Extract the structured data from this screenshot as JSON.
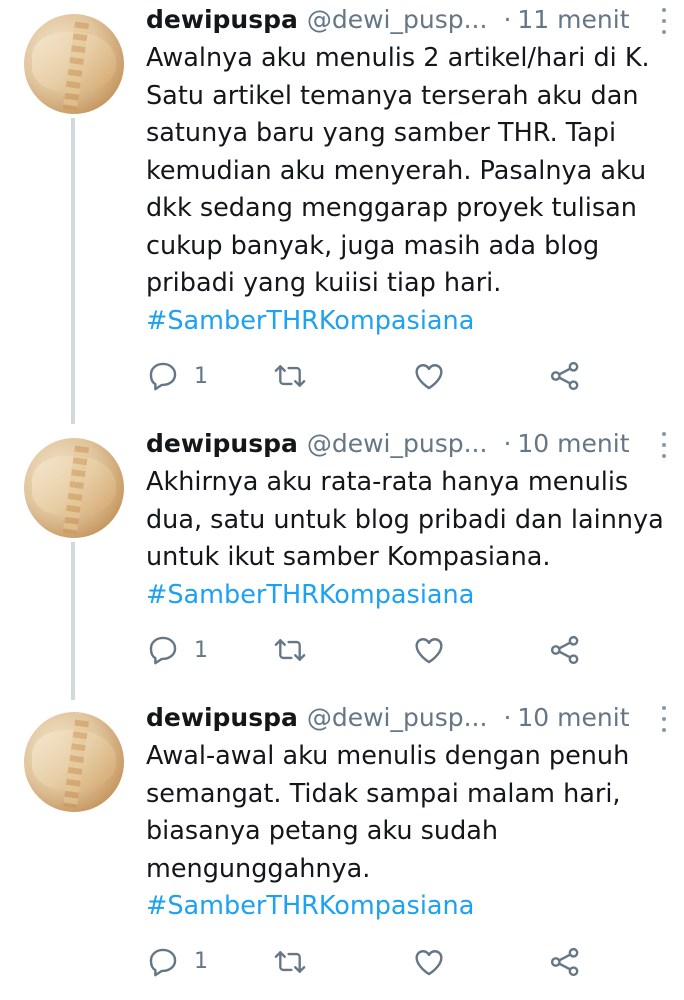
{
  "tweets": [
    {
      "name": "dewipuspa",
      "handle": "@dewi_pusp...",
      "time": "11 menit",
      "lines": [
        "Awalnya aku menulis 2 artikel/hari di K.",
        "Satu artikel temanya terserah aku dan",
        "satunya baru yang samber THR. Tapi",
        "kemudian aku menyerah. Pasalnya aku",
        "dkk sedang menggarap proyek tulisan",
        "cukup banyak, juga masih ada blog",
        "pribadi yang kuiisi tiap hari."
      ],
      "hashtag": "#SamberTHRKompasiana",
      "reply_count": "1",
      "icons": [
        "reply-icon",
        "retweet-icon",
        "like-icon",
        "share-icon",
        "more-icon"
      ]
    },
    {
      "name": "dewipuspa",
      "handle": "@dewi_pusp...",
      "time": "10 menit",
      "lines": [
        "Akhirnya aku rata-rata hanya menulis",
        "dua, satu untuk blog pribadi dan lainnya",
        "untuk ikut samber Kompasiana."
      ],
      "hashtag": "#SamberTHRKompasiana",
      "reply_count": "1",
      "icons": [
        "reply-icon",
        "retweet-icon",
        "like-icon",
        "share-icon",
        "more-icon"
      ]
    },
    {
      "name": "dewipuspa",
      "handle": "@dewi_pusp...",
      "time": "10 menit",
      "lines": [
        "Awal-awal aku menulis dengan penuh",
        "semangat. Tidak sampai malam hari,",
        "biasanya petang aku sudah",
        "mengunggahnya."
      ],
      "hashtag": "#SamberTHRKompasiana",
      "reply_count": "1",
      "icons": [
        "reply-icon",
        "retweet-icon",
        "like-icon",
        "share-icon",
        "more-icon"
      ]
    }
  ],
  "colors": {
    "text": "#14171a",
    "secondary": "#657786",
    "hashtag": "#1da1f2",
    "thread_line": "#cfd9de"
  }
}
